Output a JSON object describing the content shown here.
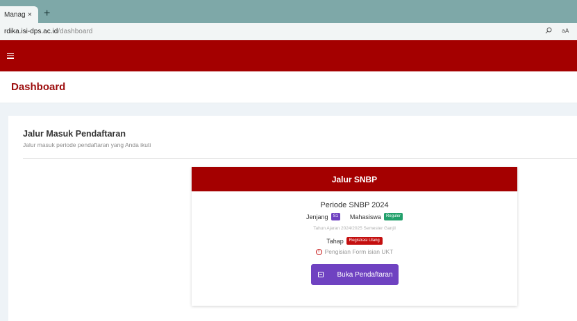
{
  "browser": {
    "tab_title": "Manag",
    "tab_close": "×",
    "new_tab": "+",
    "url_host": "rdika.isi-dps.ac.id",
    "url_path": "/dashboard"
  },
  "page": {
    "title": "Dashboard"
  },
  "card": {
    "title": "Jalur Masuk Pendaftaran",
    "subtitle": "Jalur masuk periode pendaftaran yang Anda ikuti"
  },
  "snbp": {
    "header": "Jalur SNBP",
    "periode": "Periode SNBP 2024",
    "jenjang_label": "Jenjang",
    "jenjang_value": "S1",
    "mahasiswa_label": "Mahasiswa",
    "mahasiswa_value": "Reguler",
    "tahun": "Tahun Ajaran 2024/2025 Semester Ganjil",
    "tahap_label": "Tahap",
    "tahap_value": "Registrasi Ulang",
    "info_text": "Pengisian Form isian UKT",
    "button_label": "Buka Pendaftaran"
  },
  "colors": {
    "brand_red": "#a40000",
    "purple": "#6f42c1",
    "green": "#22a06b"
  },
  "icons": [
    "hamburger-icon",
    "info-icon",
    "calendar-icon",
    "search-icon",
    "read-aloud-icon"
  ]
}
